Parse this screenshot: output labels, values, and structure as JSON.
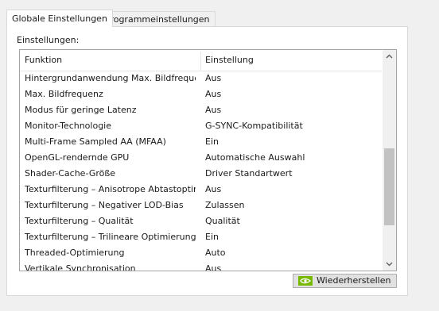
{
  "tabs": [
    {
      "label": "Globale Einstellungen",
      "active": true
    },
    {
      "label": "Programmeinstellungen",
      "active": false
    }
  ],
  "settings_label": "Einstellungen:",
  "columns": {
    "function": "Funktion",
    "setting": "Einstellung"
  },
  "rows": [
    {
      "function": "Hintergrundanwendung Max. Bildfrequenz",
      "setting": "Aus"
    },
    {
      "function": "Max. Bildfrequenz",
      "setting": "Aus"
    },
    {
      "function": "Modus für geringe Latenz",
      "setting": "Aus"
    },
    {
      "function": "Monitor-Technologie",
      "setting": "G-SYNC-Kompatibilität"
    },
    {
      "function": "Multi-Frame Sampled AA (MFAA)",
      "setting": "Ein"
    },
    {
      "function": "OpenGL-rendernde GPU",
      "setting": "Automatische Auswahl"
    },
    {
      "function": "Shader-Cache-Größe",
      "setting": "Driver Standartwert"
    },
    {
      "function": "Texturfilterung – Anisotrope Abtastoptimi...",
      "setting": "Aus"
    },
    {
      "function": "Texturfilterung – Negativer LOD-Bias",
      "setting": "Zulassen"
    },
    {
      "function": "Texturfilterung – Qualität",
      "setting": "Qualität"
    },
    {
      "function": "Texturfilterung – Trilineare Optimierung",
      "setting": "Ein"
    },
    {
      "function": "Threaded-Optimierung",
      "setting": "Auto"
    },
    {
      "function": "Vertikale Synchronisation",
      "setting": "Aus"
    }
  ],
  "restore_button": {
    "label": "Wiederherstellen",
    "icon": "nvidia-logo-icon"
  },
  "colors": {
    "nvidia_green": "#76b900",
    "scroll_thumb": "#c2c2c2"
  }
}
